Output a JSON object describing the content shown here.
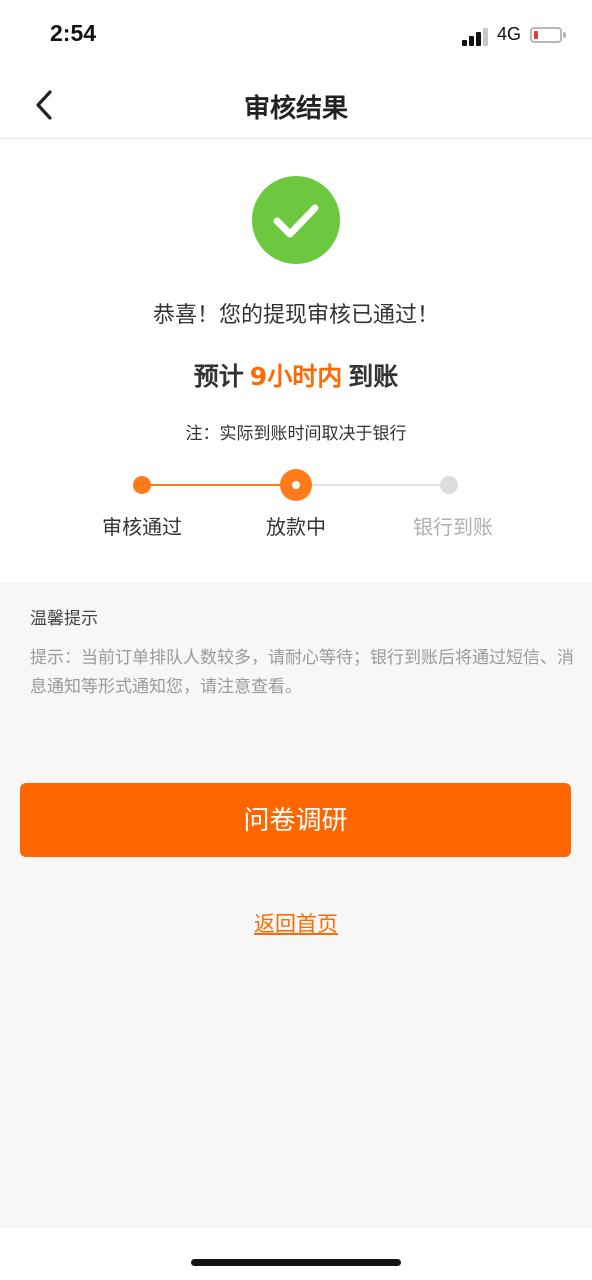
{
  "status_bar": {
    "time": "2:54",
    "network": "4G",
    "icons": [
      "signal-icon",
      "battery-icon"
    ],
    "battery_color": "#e53935"
  },
  "nav": {
    "title": "审核结果",
    "back_icon": "chevron-left-icon"
  },
  "result": {
    "icon": "check-circle-icon",
    "icon_color": "#6cc93f",
    "congrats": "恭喜！您的提现审核已通过！",
    "eta_prefix": "预计",
    "eta_highlight": "9小时内",
    "eta_suffix": "到账",
    "note": "注：实际到账时间取决于银行"
  },
  "steps": [
    {
      "label": "审核通过",
      "state": "done"
    },
    {
      "label": "放款中",
      "state": "current"
    },
    {
      "label": "银行到账",
      "state": "pending"
    }
  ],
  "tips": {
    "title": "温馨提示",
    "body": "提示：当前订单排队人数较多，请耐心等待；银行到账后将通过短信、消息通知等形式通知您，请注意查看。"
  },
  "actions": {
    "survey_label": "问卷调研",
    "home_label": "返回首页"
  },
  "colors": {
    "accent": "#ff6600",
    "success": "#6cc93f",
    "pending": "#dcdcdc"
  }
}
